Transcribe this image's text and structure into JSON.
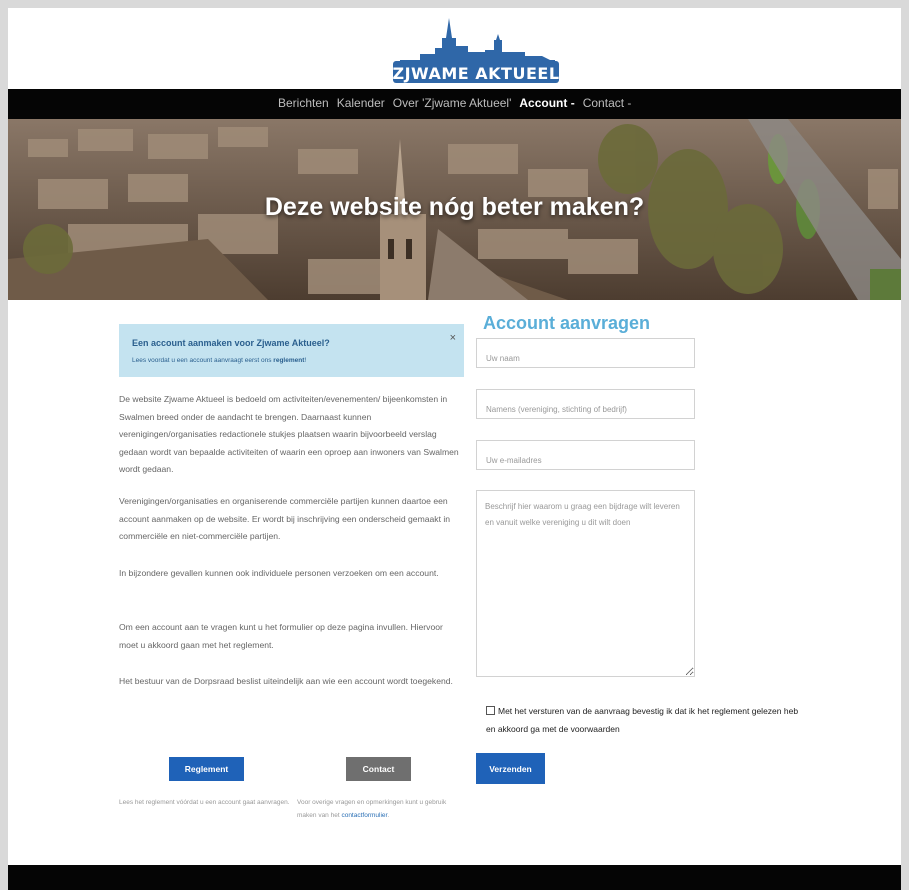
{
  "header": {
    "logo_text": "ZJWAME AKTUEEL"
  },
  "nav": {
    "items": [
      {
        "label": "Berichten"
      },
      {
        "label": "Kalender"
      },
      {
        "label": "Over 'Zjwame Aktueel'"
      },
      {
        "label": "Account -"
      },
      {
        "label": "Contact -"
      }
    ],
    "active_index": 3
  },
  "hero": {
    "title": "Deze website nóg beter maken?"
  },
  "alert": {
    "title": "Een account aanmaken voor Zjwame Aktueel?",
    "text": "Lees voordat u een account aanvraagt eerst ons",
    "link": "reglement",
    "text_end": "!",
    "close": "×"
  },
  "content": {
    "paragraphs": [
      "De website Zjwame Aktueel is bedoeld om activiteiten/evenementen/ bijeenkomsten in Swalmen breed onder de aandacht te brengen. Daarnaast kunnen verenigingen/organisaties redactionele stukjes plaatsen waarin bijvoorbeeld verslag gedaan wordt van bepaalde activiteiten of waarin een oproep aan inwoners van Swalmen wordt gedaan.",
      "Verenigingen/organisaties en organiserende commerciële partijen kunnen daartoe een account aanmaken op de website. Er wordt bij inschrijving een onderscheid gemaakt in commerciële en niet-commerciële partijen.",
      "In bijzondere gevallen kunnen ook individuele personen verzoeken om een account.",
      "Om een account aan te vragen kunt u het formulier op deze pagina invullen. Hiervoor moet u akkoord gaan met het reglement.",
      "Het bestuur van de Dorpsraad beslist uiteindelijk aan wie een account wordt toegekend."
    ]
  },
  "form": {
    "title": "Account aanvragen",
    "name_placeholder": "Uw naam",
    "org_placeholder": "Namens (vereniging, stichting of bedrijf)",
    "email_placeholder": "Uw e-mailadres",
    "message_placeholder": "Beschrijf hier waarom u graag een bijdrage wilt leveren en vanuit welke vereniging u dit wilt doen",
    "consent": "Met het versturen van de aanvraag bevestig ik dat ik het reglement gelezen heb en akkoord ga met de voorwaarden",
    "submit": "Verzenden"
  },
  "bottom": {
    "reglement_button": "Reglement",
    "reglement_text": "Lees het reglement vóórdat u een account gaat aanvragen.",
    "contact_button": "Contact",
    "contact_text": "Voor overige vragen en opmerkingen kunt u gebruik maken van het",
    "contact_link": "contactformulier",
    "contact_text_end": "."
  },
  "colors": {
    "accent": "#1f62b8",
    "logo": "#2f67a8",
    "form_title": "#5aaed8",
    "alert_bg": "#c4e3f0"
  }
}
